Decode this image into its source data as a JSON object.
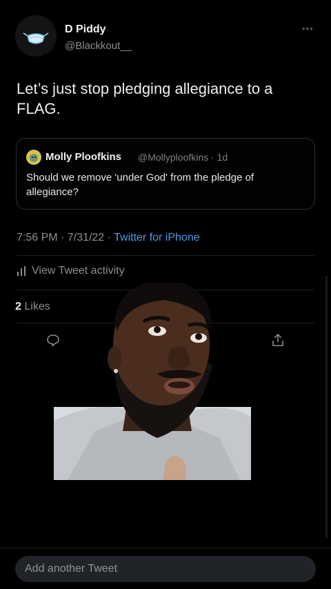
{
  "tweet": {
    "author_name": "D Piddy",
    "author_handle": "@Blackkout__",
    "text": "Let’s just stop pledging allegiance to a FLAG.",
    "more_icon": "more-horizontal-icon",
    "quoted": {
      "author_name": "Molly Ploofkins",
      "author_handle_time": "@Mollyploofkins · 1d",
      "text": "Should we remove 'under God' from the pledge of allegiance?"
    },
    "time_date": "7:56 PM · 7/31/22 · ",
    "source": "Twitter for iPhone",
    "activity_label": "View Tweet activity",
    "likes_count": "2",
    "likes_label": "Likes"
  },
  "compose": {
    "placeholder": "Add another Tweet"
  },
  "colors": {
    "background": "#000000",
    "link": "#4c9be8",
    "muted": "#8b8f94"
  }
}
